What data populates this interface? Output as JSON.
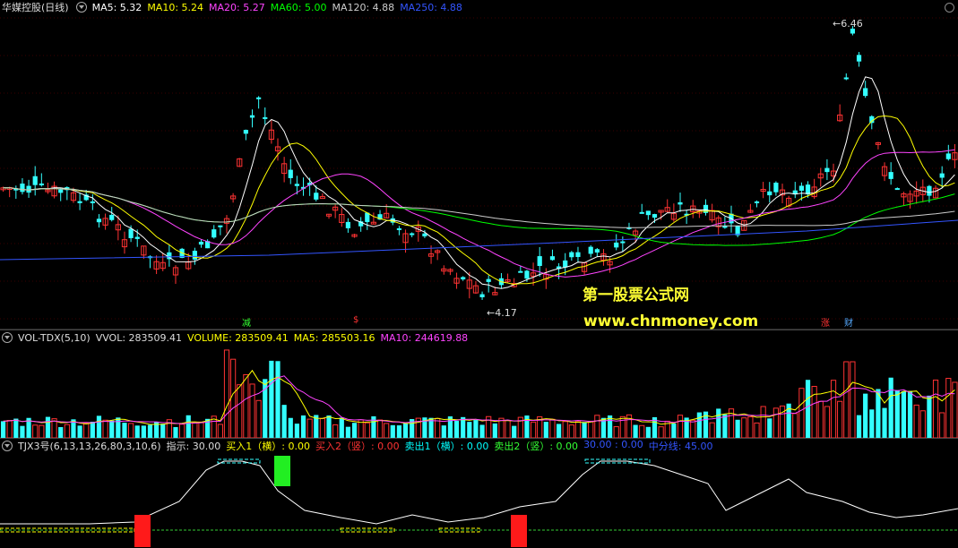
{
  "main": {
    "title": "华媒控股(日线)",
    "indicators": [
      {
        "label": "MA5: 5.32",
        "color": "#ffffff"
      },
      {
        "label": "MA10: 5.24",
        "color": "#ffff00"
      },
      {
        "label": "MA20: 5.27",
        "color": "#ff44ff"
      },
      {
        "label": "MA60: 5.00",
        "color": "#00ff00"
      },
      {
        "label": "MA120: 4.88",
        "color": "#cccccc"
      },
      {
        "label": "MA250: 4.88",
        "color": "#3355ff"
      }
    ],
    "high_label": "6.46",
    "low_label": "4.17",
    "markers": [
      {
        "text": "减",
        "color": "#33ff33"
      },
      {
        "text": "$",
        "color": "#ff3333"
      },
      {
        "text": "涨",
        "color": "#ff3333"
      },
      {
        "text": "财",
        "color": "#55aaff"
      }
    ],
    "watermark_line1": "第一股票公式网",
    "watermark_line2": "www.chnmoney.com"
  },
  "volume": {
    "name": "VOL-TDX(5,10)",
    "indicators": [
      {
        "label": "VVOL: 283509.41",
        "color": "#dddddd"
      },
      {
        "label": "VOLUME: 283509.41",
        "color": "#ffff00"
      },
      {
        "label": "MA5: 285503.16",
        "color": "#ffff00"
      },
      {
        "label": "MA10: 244619.88",
        "color": "#ff44ff"
      }
    ]
  },
  "tjx": {
    "name": "TJX3号(6,13,13,26,80,3,10,6)",
    "indicators": [
      {
        "label": "指示: 30.00",
        "color": "#dddddd"
      },
      {
        "label": "买入1（横）: 0.00",
        "color": "#ffff00"
      },
      {
        "label": "买入2（竖）: 0.00",
        "color": "#ff3333"
      },
      {
        "label": "卖出1（横）: 0.00",
        "color": "#00ffff"
      },
      {
        "label": "卖出2（竖）: 0.00",
        "color": "#33ff33"
      },
      {
        "label": "30.00 : 0.00",
        "color": "#3355ff"
      },
      {
        "label": "中分线: 45.00",
        "color": "#3355ff"
      }
    ]
  }
}
